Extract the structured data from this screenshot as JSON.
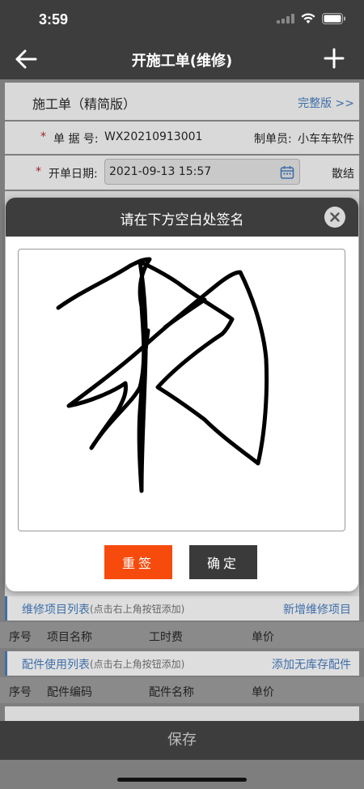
{
  "status": {
    "time": "3:59"
  },
  "nav": {
    "title": "开施工单(维修)"
  },
  "order": {
    "version_label": "施工单（精简版）",
    "full_version_link": "完整版 >>",
    "doc_no_label": "单 据 号:",
    "doc_no_value": "WX20210913001",
    "creator_label": "制单员:",
    "creator_value": "小车车软件",
    "date_label": "开单日期:",
    "date_value": "2021-09-13 15:57",
    "settle_label": "散结"
  },
  "repair_section": {
    "title": "维修项目列表",
    "hint": "(点击右上角按钮添加)",
    "action": "新增维修项目",
    "columns": [
      "序号",
      "项目名称",
      "工时费",
      "单价"
    ]
  },
  "parts_section": {
    "title": "配件使用列表",
    "hint": "(点击右上角按钮添加)",
    "action": "添加无库存配件",
    "columns": [
      "序号",
      "配件编码",
      "配件名称",
      "单价"
    ]
  },
  "bottom": {
    "save_label": "保存"
  },
  "modal": {
    "title": "请在下方空白处签名",
    "resign_label": "重签",
    "confirm_label": "确定"
  },
  "colors": {
    "accent_orange": "#f64b0c",
    "dark_bar": "#3d3d3d",
    "link_blue": "#3f6fa8"
  }
}
